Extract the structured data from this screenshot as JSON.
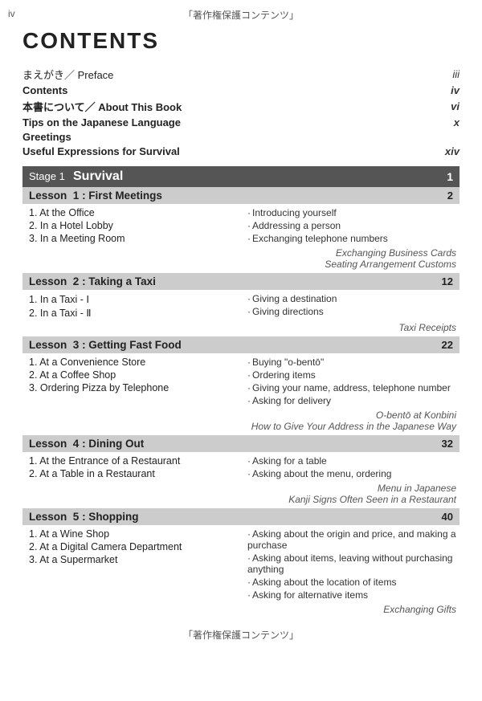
{
  "page": {
    "top_watermark": "「著作権保護コンテンツ」",
    "bottom_watermark": "「著作権保護コンテンツ」",
    "page_num": "iv",
    "title": "CONTENTS"
  },
  "intro_items": [
    {
      "label": "まえがき／ Preface",
      "bold": false,
      "page": "iii"
    },
    {
      "label": "Contents",
      "bold": true,
      "page": "iv"
    },
    {
      "label": "本書について／ About This Book",
      "bold": true,
      "page": "vi"
    },
    {
      "label": "Tips on the Japanese Language",
      "bold": true,
      "page": "x"
    },
    {
      "label": "Greetings",
      "bold": true,
      "page": ""
    },
    {
      "label": "Useful Expressions for Survival",
      "bold": true,
      "page": "xiv"
    }
  ],
  "stages": [
    {
      "stage_label": "Stage 1",
      "stage_title": "Survival",
      "stage_page": "1",
      "lessons": [
        {
          "lesson_label": "Lesson",
          "lesson_num": "1",
          "lesson_title": ": First Meetings",
          "lesson_page": "2",
          "items": [
            "1.  At the Office",
            "2.  In a Hotel Lobby",
            "3.  In a Meeting Room"
          ],
          "desc": [
            "Introducing yourself",
            "Addressing a person",
            "Exchanging telephone numbers"
          ],
          "side_notes": [
            "Exchanging Business Cards",
            "Seating Arrangement Customs"
          ]
        },
        {
          "lesson_label": "Lesson",
          "lesson_num": "2",
          "lesson_title": ": Taking a Taxi",
          "lesson_page": "12",
          "items": [
            "1.  In a Taxi - Ⅰ",
            "2.  In a Taxi - Ⅱ"
          ],
          "desc": [
            "Giving a destination",
            "Giving directions"
          ],
          "side_notes": [
            "Taxi Receipts"
          ]
        },
        {
          "lesson_label": "Lesson",
          "lesson_num": "3",
          "lesson_title": ": Getting Fast Food",
          "lesson_page": "22",
          "items": [
            "1.  At a Convenience Store",
            "2.  At a Coffee Shop",
            "3.  Ordering Pizza by Telephone"
          ],
          "desc": [
            "Buying \"o-bentō\"",
            "Ordering items",
            "Giving your name, address, telephone number",
            "Asking for delivery"
          ],
          "side_notes": [
            "O-bentō at Konbini",
            "How to Give Your Address in the Japanese Way"
          ]
        },
        {
          "lesson_label": "Lesson",
          "lesson_num": "4",
          "lesson_title": ": Dining Out",
          "lesson_page": "32",
          "items": [
            "1.  At the Entrance of a Restaurant",
            "2.  At a Table in a Restaurant"
          ],
          "desc": [
            "Asking for a table",
            "Asking about the menu, ordering"
          ],
          "side_notes": [
            "Menu in Japanese",
            "Kanji Signs Often Seen in a Restaurant"
          ]
        },
        {
          "lesson_label": "Lesson",
          "lesson_num": "5",
          "lesson_title": ": Shopping",
          "lesson_page": "40",
          "items": [
            "1.  At a Wine Shop",
            "2.  At a Digital Camera Department",
            "3.  At a Supermarket"
          ],
          "desc": [
            "Asking about the origin and price, and making a purchase",
            "Asking about items, leaving without purchasing anything",
            "Asking about the location of items",
            "Asking for alternative items"
          ],
          "side_notes": [
            "Exchanging Gifts"
          ]
        }
      ]
    }
  ]
}
